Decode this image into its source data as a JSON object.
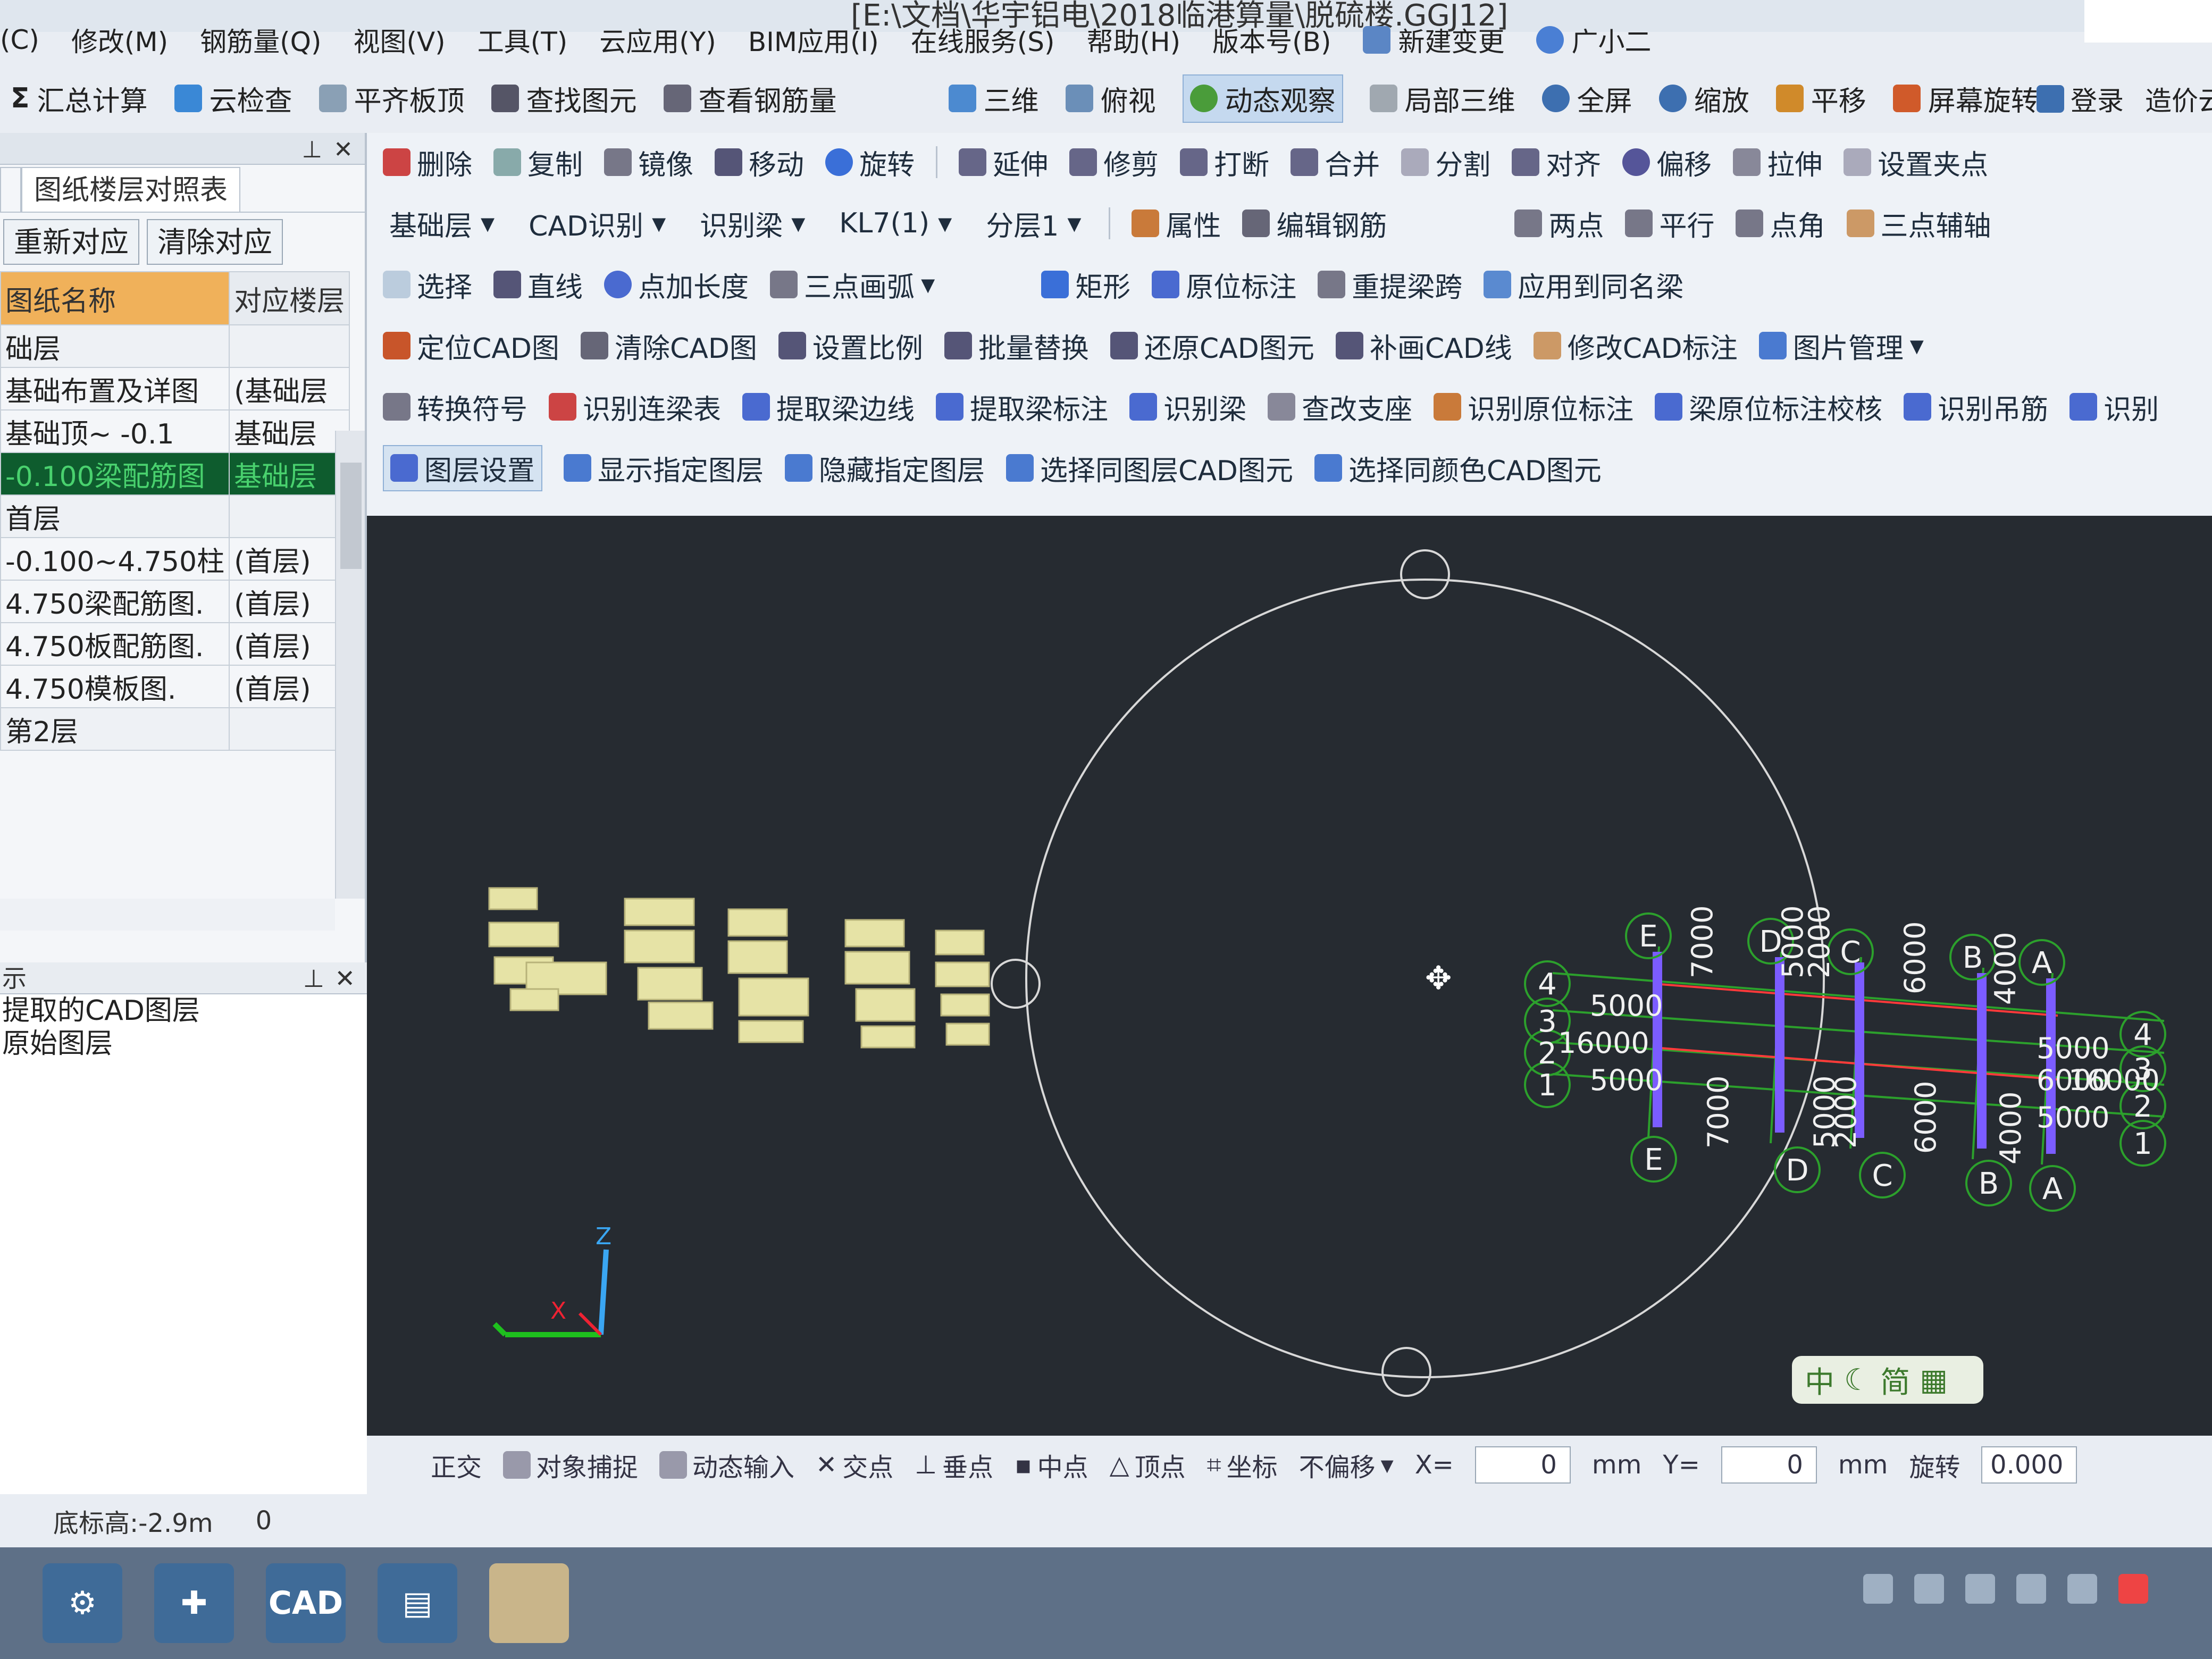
{
  "window": {
    "title": "[E:\\文档\\华宇铝电\\2018临港算量\\脱硫楼.GGJ12]"
  },
  "menu": [
    "(C)",
    "修改(M)",
    "钢筋量(Q)",
    "视图(V)",
    "工具(T)",
    "云应用(Y)",
    "BIM应用(I)",
    "在线服务(S)",
    "帮助(H)",
    "版本号(B)",
    "新建变更",
    "广小二"
  ],
  "global_toolbar": {
    "items": [
      "汇总计算",
      "云检查",
      "平齐板顶",
      "查找图元",
      "查看钢筋量"
    ],
    "view_items": [
      "三维",
      "俯视",
      "动态观察",
      "局部三维",
      "全屏",
      "缩放",
      "平移",
      "屏幕旋转"
    ],
    "login": "登录",
    "price": "造价云"
  },
  "left_panel": {
    "tab": "图纸楼层对照表",
    "buttons": [
      "重新对应",
      "清除对应"
    ],
    "columns": [
      "图纸名称",
      "对应楼层"
    ],
    "rows": [
      {
        "name": "础层",
        "floor": "",
        "type": "grp"
      },
      {
        "name": "基础布置及详图",
        "floor": "(基础层",
        "type": "row"
      },
      {
        "name": "基础顶~ -0.1",
        "floor": "基础层",
        "type": "row"
      },
      {
        "name": "-0.100梁配筋图",
        "floor": "基础层",
        "type": "hl"
      },
      {
        "name": "首层",
        "floor": "",
        "type": "grp"
      },
      {
        "name": "-0.100~4.750柱",
        "floor": "(首层)",
        "type": "row"
      },
      {
        "name": "4.750梁配筋图.",
        "floor": "(首层)",
        "type": "row"
      },
      {
        "name": "4.750板配筋图.",
        "floor": "(首层)",
        "type": "row"
      },
      {
        "name": "4.750模板图.",
        "floor": "(首层)",
        "type": "row"
      },
      {
        "name": "第2层",
        "floor": "",
        "type": "grp"
      }
    ],
    "layer_panel_title": "示",
    "layer_options": [
      "提取的CAD图层",
      "原始图层"
    ]
  },
  "ribbon": {
    "row1": [
      "删除",
      "复制",
      "镜像",
      "移动",
      "旋转",
      "延伸",
      "修剪",
      "打断",
      "合并",
      "分割",
      "对齐",
      "偏移",
      "拉伸",
      "设置夹点"
    ],
    "row2": {
      "floor": "基础层",
      "mode": "CAD识别",
      "sub": "识别梁",
      "element": "KL7(1)",
      "layer": "分层1",
      "tools": [
        "属性",
        "编辑钢筋"
      ],
      "right": [
        "两点",
        "平行",
        "点角",
        "三点辅轴"
      ]
    },
    "row3": [
      "选择",
      "直线",
      "点加长度",
      "三点画弧",
      "矩形",
      "原位标注",
      "重提梁跨",
      "应用到同名梁"
    ],
    "row4": [
      "定位CAD图",
      "清除CAD图",
      "设置比例",
      "批量替换",
      "还原CAD图元",
      "补画CAD线",
      "修改CAD标注",
      "图片管理"
    ],
    "row5": [
      "转换符号",
      "识别连梁表",
      "提取梁边线",
      "提取梁标注",
      "识别梁",
      "查改支座",
      "识别原位标注",
      "梁原位标注校核",
      "识别吊筋",
      "识别"
    ],
    "row6": [
      "图层设置",
      "显示指定图层",
      "隐藏指定图层",
      "选择同图层CAD图元",
      "选择同颜色CAD图元"
    ]
  },
  "canvas": {
    "axes_top": [
      "E",
      "D",
      "C",
      "B",
      "A"
    ],
    "axes_bottom": [
      "E",
      "D",
      "C",
      "B",
      "A"
    ],
    "axes_left": [
      "4",
      "3",
      "2",
      "1"
    ],
    "axes_right": [
      "4",
      "3",
      "2",
      "1"
    ],
    "dims_vertical": [
      "7000",
      "5000",
      "2000",
      "6000",
      "4000"
    ],
    "dims_horizontal": [
      "5000",
      "16000",
      "5000"
    ],
    "dims_right": [
      "5000",
      "6000",
      "5000",
      "16000"
    ],
    "axis_label_z": "Z",
    "axis_label_x": "X",
    "ime": [
      "中",
      "简"
    ]
  },
  "snapbar": {
    "items": [
      "正交",
      "对象捕捉",
      "动态输入",
      "交点",
      "垂点",
      "中点",
      "顶点",
      "坐标",
      "不偏移"
    ],
    "x_label": "X=",
    "x_value": "0",
    "unit": "mm",
    "y_label": "Y=",
    "y_value": "0",
    "rotate_label": "旋转",
    "rotate_value": "0.000"
  },
  "statusbar": {
    "elevation": "底标高:-2.9m",
    "value": "0"
  },
  "colors": {
    "accent": "#f0b15a",
    "highlight": "#0e5c2e",
    "canvas": "#262b31",
    "axis_green": "#2ca02c",
    "beam_purple": "#7b5cff"
  }
}
